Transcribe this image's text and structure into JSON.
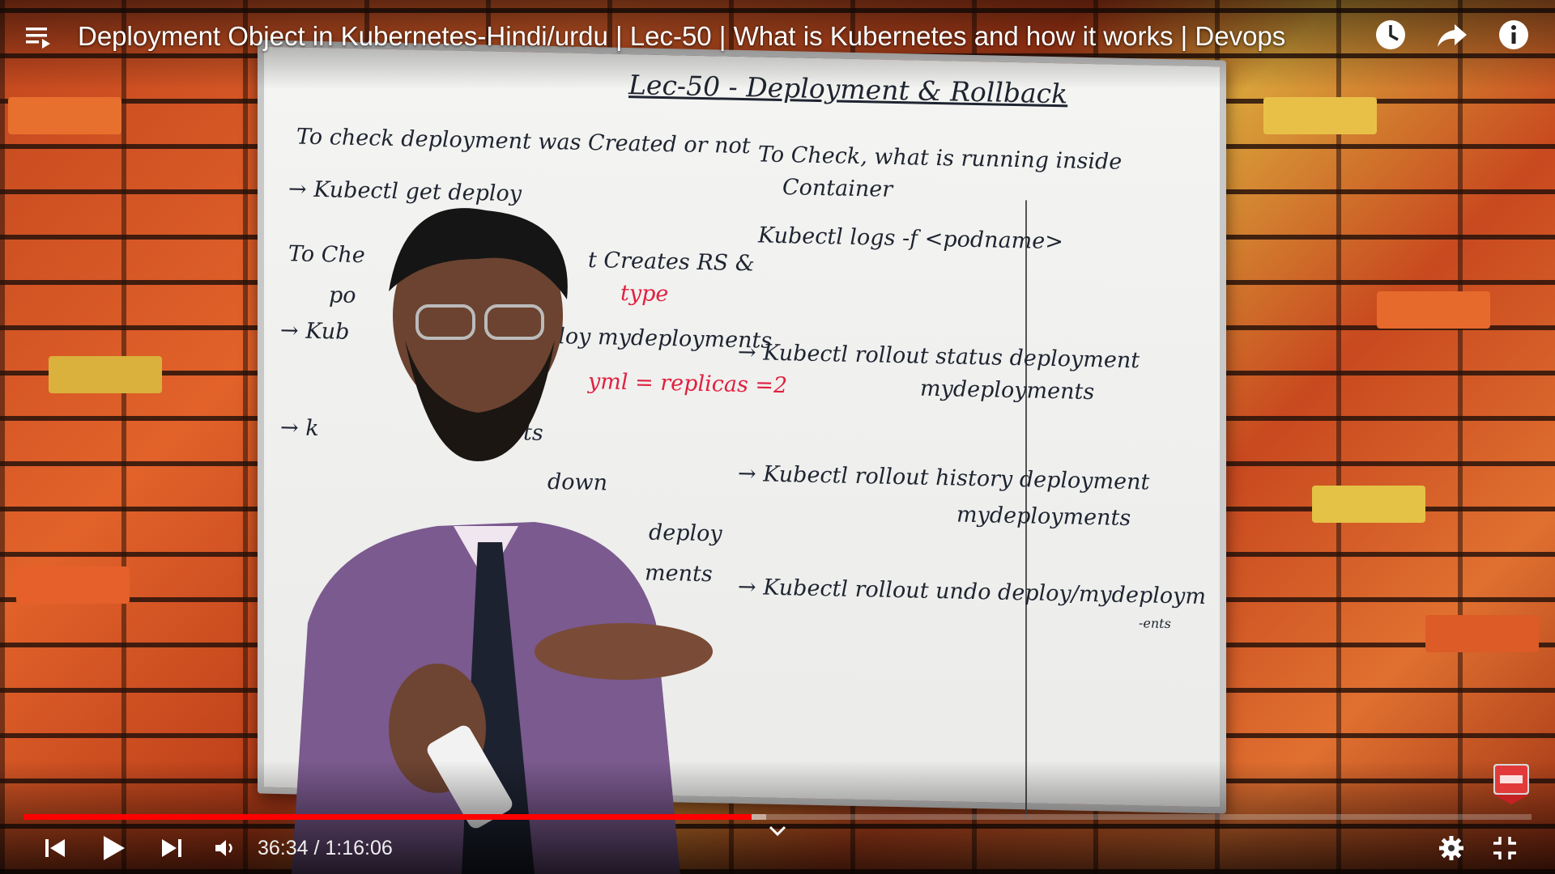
{
  "video": {
    "title": "Deployment Object in Kubernetes-Hindi/urdu | Lec-50 | What is Kubernetes and how it works | Devops",
    "progress": 0.4826,
    "buffered": 0.4926
  },
  "whiteboard": {
    "title": "Lec-50 - Deployment & Rollback",
    "left": [
      "To check deployment was Created or not",
      "→ Kubectl get deploy",
      "To Che",
      "t Creates RS &",
      "po",
      "type",
      "→ Kub",
      "eploy mydeployments",
      "yml = replicas =2",
      "→ k",
      "ts",
      "down",
      "deploy",
      "ments"
    ],
    "right": [
      "To Check, what is running inside",
      "Container",
      "Kubectl logs -f <podname>",
      "→ Kubectl rollout status deployment",
      "mydeployments",
      "→ Kubectl rollout history deployment",
      "mydeployments",
      "→ Kubectl rollout undo deploy/mydeploym",
      "-ents"
    ]
  },
  "player": {
    "time": "36:34 / 1:16:06"
  },
  "icons": {
    "playlist": "playlist-icon",
    "watch_later": "clock-icon",
    "share": "share-icon",
    "info": "info-icon",
    "prev": "skip-previous-icon",
    "play": "play-icon",
    "next": "skip-next-icon",
    "volume": "volume-icon",
    "chevron": "chevron-down-icon",
    "settings": "gear-icon",
    "exit_fullscreen": "exit-fullscreen-icon",
    "subscribe": "subscribe-icon"
  },
  "colors": {
    "progress_played": "#ff0000",
    "marker_red": "#e02040"
  }
}
